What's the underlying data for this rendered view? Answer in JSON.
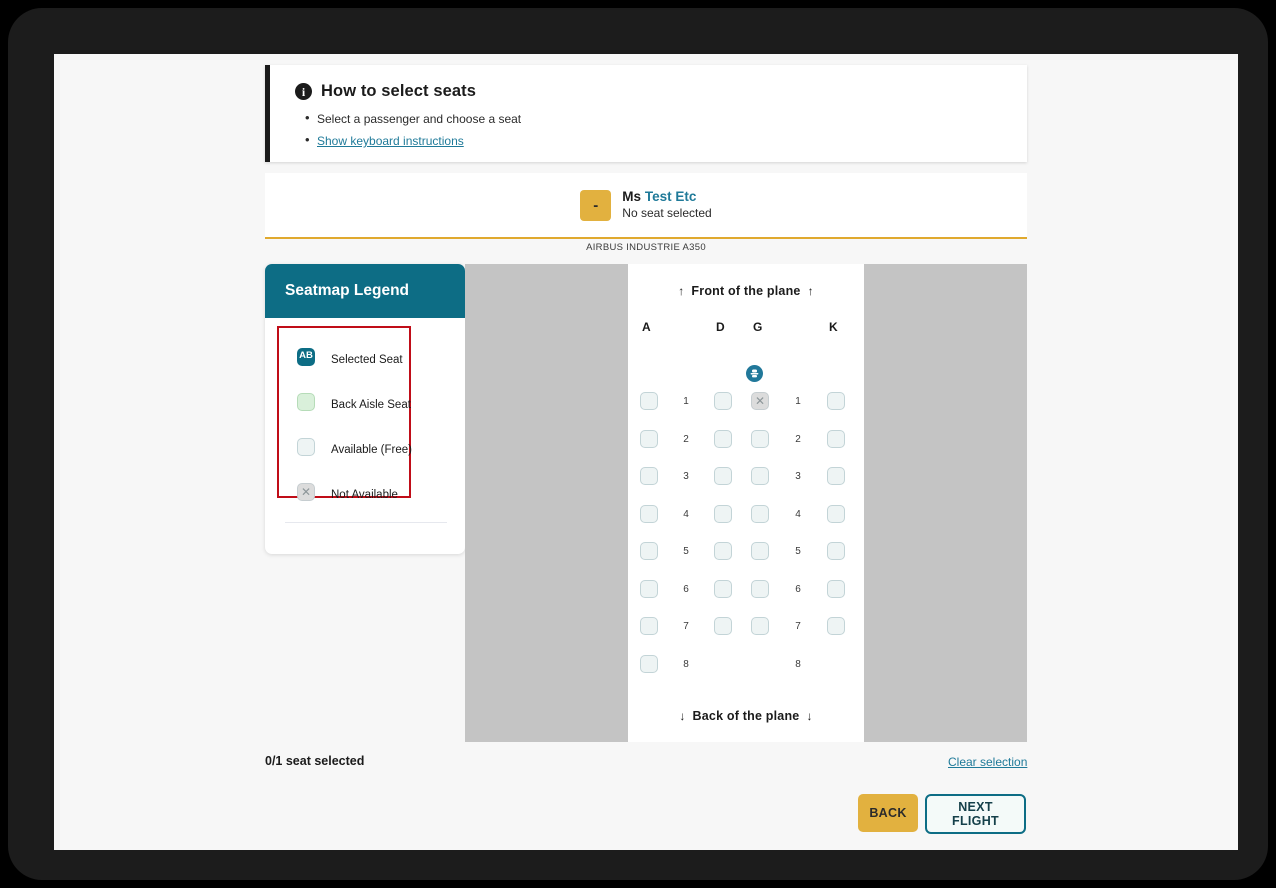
{
  "howto": {
    "icon": "info-icon",
    "title": "How to select seats",
    "bullets": [
      "Select a passenger and choose a seat"
    ],
    "link_label": "Show keyboard instructions"
  },
  "passenger": {
    "avatar_label": "-",
    "title": "Ms",
    "name": "Test Etc",
    "seat_status": "No seat selected"
  },
  "aircraft": {
    "label": "AIRBUS INDUSTRIE A350"
  },
  "legend": {
    "header": "Seatmap Legend",
    "items": [
      {
        "type": "selected",
        "code": "AB",
        "label": "Selected Seat"
      },
      {
        "type": "green",
        "code": "",
        "label": "Back Aisle Seat"
      },
      {
        "type": "free",
        "code": "",
        "label": "Available (Free)"
      },
      {
        "type": "blocked",
        "code": "×",
        "label": "Not Available"
      }
    ],
    "highlight_color": "#c00d18"
  },
  "seatmap": {
    "front_label": "Front of the plane",
    "back_label": "Back of the plane",
    "front_arrow": "↑",
    "back_arrow": "↓",
    "columns": [
      "A",
      "D",
      "G",
      "K"
    ],
    "lavatory_icon": "lavatory-icon",
    "rows": [
      {
        "number": "1",
        "seats": {
          "A": "free",
          "D": "free",
          "G": "blocked",
          "K": "free"
        }
      },
      {
        "number": "2",
        "seats": {
          "A": "free",
          "D": "free",
          "G": "free",
          "K": "free"
        }
      },
      {
        "number": "3",
        "seats": {
          "A": "free",
          "D": "free",
          "G": "free",
          "K": "free"
        }
      },
      {
        "number": "4",
        "seats": {
          "A": "free",
          "D": "free",
          "G": "free",
          "K": "free"
        }
      },
      {
        "number": "5",
        "seats": {
          "A": "free",
          "D": "free",
          "G": "free",
          "K": "free"
        }
      },
      {
        "number": "6",
        "seats": {
          "A": "free",
          "D": "free",
          "G": "free",
          "K": "free"
        }
      },
      {
        "number": "7",
        "seats": {
          "A": "free",
          "D": "free",
          "G": "free",
          "K": "free"
        }
      },
      {
        "number": "8",
        "seats": {
          "A": "free",
          "D": "none",
          "G": "none",
          "K": "none"
        }
      }
    ]
  },
  "footer": {
    "selected_count": "0/1 seat selected",
    "clear_label": "Clear selection",
    "back_label": "BACK",
    "next_label": "NEXT FLIGHT"
  },
  "colors": {
    "teal": "#0d6d85",
    "amber": "#e2b13f",
    "link": "#1f7a99",
    "red_highlight": "#c00d18",
    "panel_gray": "#c4c4c4"
  }
}
